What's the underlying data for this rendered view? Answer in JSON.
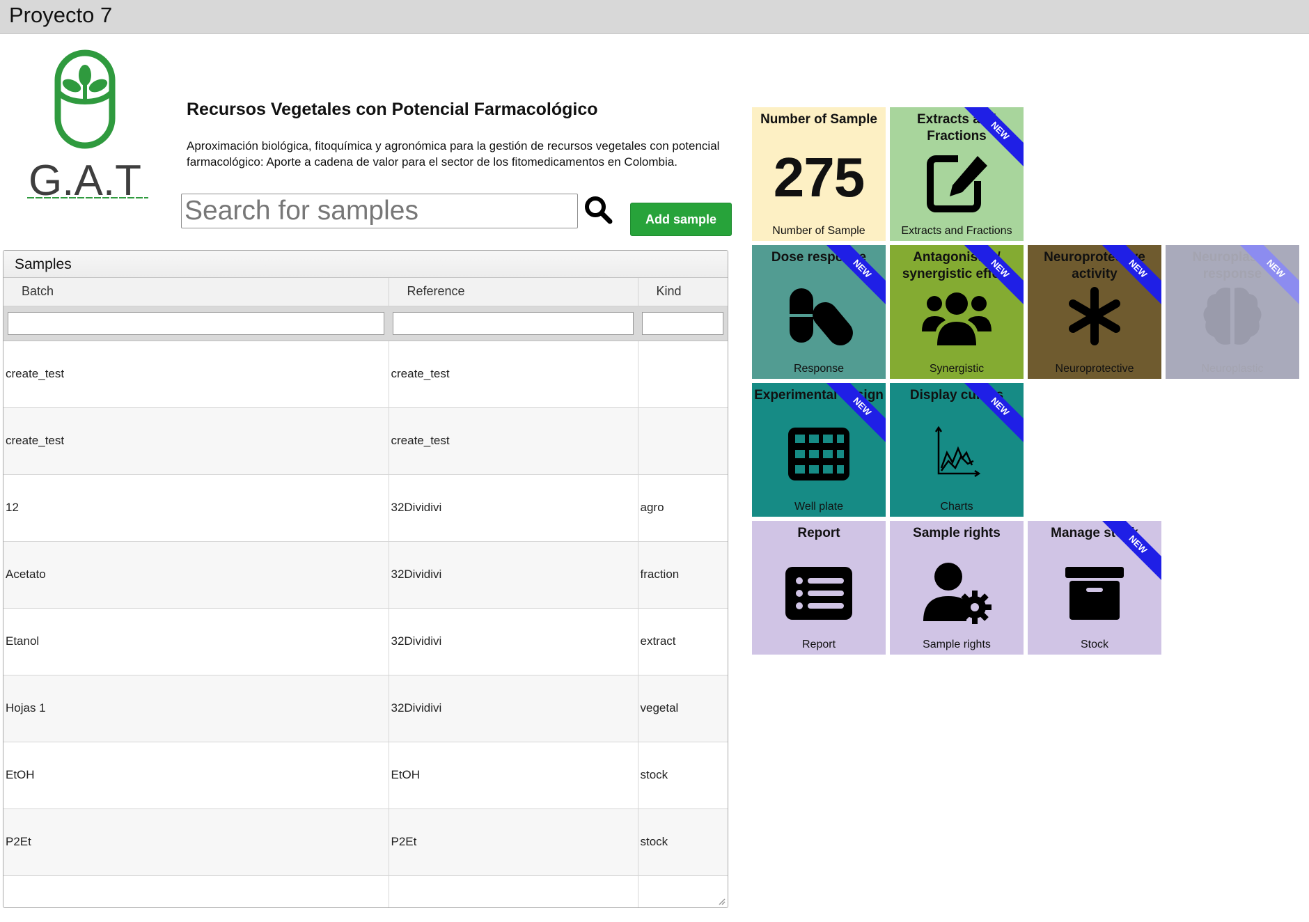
{
  "window": {
    "title": "Proyecto 7"
  },
  "logo": {
    "text": "G.A.T"
  },
  "header": {
    "title": "Recursos Vegetales con Potencial Farmacológico",
    "description": "Aproximación biológica, fitoquímica y agronómica para la gestión de recursos vegetales con potencial farmacológico: Aporte a cadena de valor para el sector de los fitomedicamentos en Colombia."
  },
  "search": {
    "placeholder": "Search for samples",
    "value": ""
  },
  "add_button": {
    "label": "Add sample"
  },
  "samples_panel": {
    "title": "Samples",
    "columns": [
      "Batch",
      "Reference",
      "Kind"
    ],
    "rows": [
      {
        "batch": "create_test",
        "reference": "create_test",
        "kind": ""
      },
      {
        "batch": "create_test",
        "reference": "create_test",
        "kind": ""
      },
      {
        "batch": "12",
        "reference": "32Dividivi",
        "kind": "agro"
      },
      {
        "batch": "Acetato",
        "reference": "32Dividivi",
        "kind": "fraction"
      },
      {
        "batch": "Etanol",
        "reference": "32Dividivi",
        "kind": "extract"
      },
      {
        "batch": "Hojas 1",
        "reference": "32Dividivi",
        "kind": "vegetal"
      },
      {
        "batch": "EtOH",
        "reference": "EtOH",
        "kind": "stock"
      },
      {
        "batch": "P2Et",
        "reference": "P2Et",
        "kind": "stock"
      }
    ]
  },
  "tiles": {
    "number_of_sample": {
      "title": "Number of Sample",
      "value": "275",
      "label": "Number of Sample",
      "color": "#fdf0c4"
    },
    "extracts": {
      "title": "Extracts and Fractions",
      "label": "Extracts and Fractions",
      "badge": "NEW",
      "icon": "edit-icon",
      "color": "#a8d59c"
    },
    "dose_response": {
      "title": "Dose response",
      "label": "Response",
      "badge": "NEW",
      "icon": "pills-icon",
      "color": "#529c92"
    },
    "antagonistic": {
      "title": "Antagonistic / synergistic effect",
      "label": "Synergistic",
      "badge": "NEW",
      "icon": "users-icon",
      "color": "#84ab32"
    },
    "neuroprotective": {
      "title": "Neuroprotective activity",
      "label": "Neuroprotective",
      "badge": "NEW",
      "icon": "asterisk-icon",
      "color": "#6f5b2f"
    },
    "neuroplastic": {
      "title": "Neuroplastic response",
      "label": "Neuroplastic",
      "badge": "NEW",
      "icon": "brain-icon",
      "color": "#a9aabb"
    },
    "experimental_design": {
      "title": "Experimental design",
      "label": "Well plate",
      "badge": "NEW",
      "icon": "grid-icon",
      "color": "#168b85"
    },
    "display_curves": {
      "title": "Display curves",
      "label": "Charts",
      "badge": "NEW",
      "icon": "chart-icon",
      "color": "#168b85"
    },
    "report": {
      "title": "Report",
      "label": "Report",
      "icon": "list-icon",
      "color": "#d0c4e5"
    },
    "sample_rights": {
      "title": "Sample rights",
      "label": "Sample rights",
      "icon": "user-gear-icon",
      "color": "#d0c4e5"
    },
    "manage_stock": {
      "title": "Manage stock",
      "label": "Stock",
      "badge": "NEW",
      "icon": "archive-icon",
      "color": "#d0c4e5"
    }
  }
}
